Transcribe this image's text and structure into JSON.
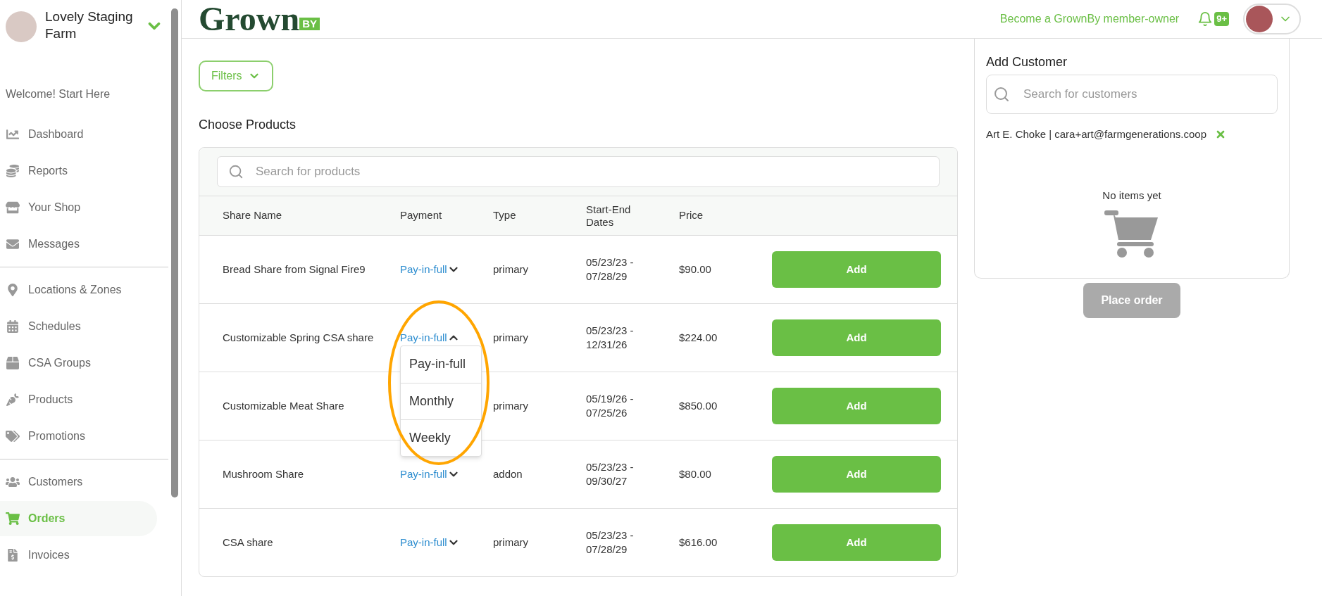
{
  "sidebar": {
    "farm_name": "Lovely Staging Farm",
    "welcome": "Welcome! Start Here",
    "sections": [
      [
        {
          "label": "Dashboard",
          "selected": false
        },
        {
          "label": "Reports",
          "selected": false
        },
        {
          "label": "Your Shop",
          "selected": false
        },
        {
          "label": "Messages",
          "selected": false
        }
      ],
      [
        {
          "label": "Locations & Zones",
          "selected": false
        },
        {
          "label": "Schedules",
          "selected": false
        },
        {
          "label": "CSA Groups",
          "selected": false
        },
        {
          "label": "Products",
          "selected": false
        },
        {
          "label": "Promotions",
          "selected": false
        }
      ],
      [
        {
          "label": "Customers",
          "selected": false
        },
        {
          "label": "Orders",
          "selected": true
        },
        {
          "label": "Invoices",
          "selected": false
        }
      ]
    ]
  },
  "header": {
    "logo_text": "Grown",
    "logo_tag": "BY",
    "member_link": "Become a GrownBy member-owner",
    "notification_count": "9+"
  },
  "filters_button": "Filters",
  "products": {
    "title": "Choose Products",
    "search": {
      "placeholder": "Search for products"
    },
    "columns": [
      "Share Name",
      "Payment",
      "Type",
      "Start-End Dates",
      "Price"
    ],
    "rows": [
      {
        "name": "Bread Share from Signal Fire9",
        "payment": "Pay-in-full",
        "expanded": false,
        "type": "primary",
        "dates": "05/23/23 - 07/28/29",
        "price": "$90.00",
        "action": "Add"
      },
      {
        "name": "Customizable Spring CSA share",
        "payment": "Pay-in-full",
        "expanded": true,
        "options": [
          {
            "label": "Pay-in-full"
          },
          {
            "label": "Monthly"
          },
          {
            "label": "Weekly"
          }
        ],
        "type": "primary",
        "dates": "05/23/23 - 12/31/26",
        "price": "$224.00",
        "action": "Add"
      },
      {
        "name": "Customizable Meat Share",
        "expanded": false,
        "type": "primary",
        "dates": "05/19/26 - 07/25/26",
        "price": "$850.00",
        "action": "Add"
      },
      {
        "name": "Mushroom Share",
        "payment": "Pay-in-full",
        "expanded": false,
        "type": "addon",
        "dates": "05/23/23 - 09/30/27",
        "price": "$80.00",
        "action": "Add"
      },
      {
        "name": "CSA share",
        "payment": "Pay-in-full",
        "expanded": false,
        "type": "primary",
        "dates": "05/23/23 - 07/28/29",
        "price": "$616.00",
        "action": "Add"
      }
    ]
  },
  "customer_panel": {
    "title": "Add Customer",
    "search": {
      "placeholder": "Search for customers"
    },
    "selected_customer": "Art E. Choke | cara+art@farmgenerations.coop",
    "empty_message": "No items yet",
    "place_order": {
      "label": "Place order",
      "disabled": true
    }
  }
}
